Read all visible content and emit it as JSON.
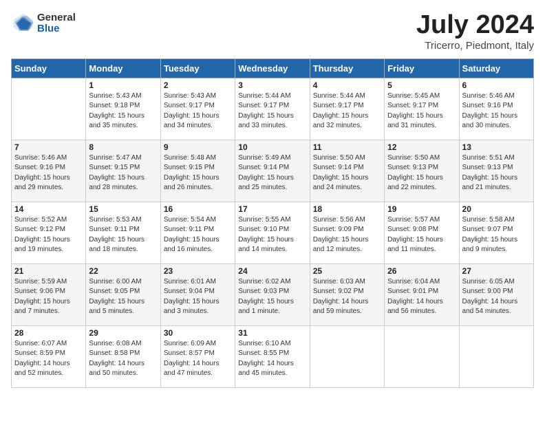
{
  "logo": {
    "general": "General",
    "blue": "Blue"
  },
  "title": "July 2024",
  "location": "Tricerro, Piedmont, Italy",
  "days_of_week": [
    "Sunday",
    "Monday",
    "Tuesday",
    "Wednesday",
    "Thursday",
    "Friday",
    "Saturday"
  ],
  "weeks": [
    [
      {
        "day": "",
        "info": ""
      },
      {
        "day": "1",
        "info": "Sunrise: 5:43 AM\nSunset: 9:18 PM\nDaylight: 15 hours\nand 35 minutes."
      },
      {
        "day": "2",
        "info": "Sunrise: 5:43 AM\nSunset: 9:17 PM\nDaylight: 15 hours\nand 34 minutes."
      },
      {
        "day": "3",
        "info": "Sunrise: 5:44 AM\nSunset: 9:17 PM\nDaylight: 15 hours\nand 33 minutes."
      },
      {
        "day": "4",
        "info": "Sunrise: 5:44 AM\nSunset: 9:17 PM\nDaylight: 15 hours\nand 32 minutes."
      },
      {
        "day": "5",
        "info": "Sunrise: 5:45 AM\nSunset: 9:17 PM\nDaylight: 15 hours\nand 31 minutes."
      },
      {
        "day": "6",
        "info": "Sunrise: 5:46 AM\nSunset: 9:16 PM\nDaylight: 15 hours\nand 30 minutes."
      }
    ],
    [
      {
        "day": "7",
        "info": "Sunrise: 5:46 AM\nSunset: 9:16 PM\nDaylight: 15 hours\nand 29 minutes."
      },
      {
        "day": "8",
        "info": "Sunrise: 5:47 AM\nSunset: 9:15 PM\nDaylight: 15 hours\nand 28 minutes."
      },
      {
        "day": "9",
        "info": "Sunrise: 5:48 AM\nSunset: 9:15 PM\nDaylight: 15 hours\nand 26 minutes."
      },
      {
        "day": "10",
        "info": "Sunrise: 5:49 AM\nSunset: 9:14 PM\nDaylight: 15 hours\nand 25 minutes."
      },
      {
        "day": "11",
        "info": "Sunrise: 5:50 AM\nSunset: 9:14 PM\nDaylight: 15 hours\nand 24 minutes."
      },
      {
        "day": "12",
        "info": "Sunrise: 5:50 AM\nSunset: 9:13 PM\nDaylight: 15 hours\nand 22 minutes."
      },
      {
        "day": "13",
        "info": "Sunrise: 5:51 AM\nSunset: 9:13 PM\nDaylight: 15 hours\nand 21 minutes."
      }
    ],
    [
      {
        "day": "14",
        "info": "Sunrise: 5:52 AM\nSunset: 9:12 PM\nDaylight: 15 hours\nand 19 minutes."
      },
      {
        "day": "15",
        "info": "Sunrise: 5:53 AM\nSunset: 9:11 PM\nDaylight: 15 hours\nand 18 minutes."
      },
      {
        "day": "16",
        "info": "Sunrise: 5:54 AM\nSunset: 9:11 PM\nDaylight: 15 hours\nand 16 minutes."
      },
      {
        "day": "17",
        "info": "Sunrise: 5:55 AM\nSunset: 9:10 PM\nDaylight: 15 hours\nand 14 minutes."
      },
      {
        "day": "18",
        "info": "Sunrise: 5:56 AM\nSunset: 9:09 PM\nDaylight: 15 hours\nand 12 minutes."
      },
      {
        "day": "19",
        "info": "Sunrise: 5:57 AM\nSunset: 9:08 PM\nDaylight: 15 hours\nand 11 minutes."
      },
      {
        "day": "20",
        "info": "Sunrise: 5:58 AM\nSunset: 9:07 PM\nDaylight: 15 hours\nand 9 minutes."
      }
    ],
    [
      {
        "day": "21",
        "info": "Sunrise: 5:59 AM\nSunset: 9:06 PM\nDaylight: 15 hours\nand 7 minutes."
      },
      {
        "day": "22",
        "info": "Sunrise: 6:00 AM\nSunset: 9:05 PM\nDaylight: 15 hours\nand 5 minutes."
      },
      {
        "day": "23",
        "info": "Sunrise: 6:01 AM\nSunset: 9:04 PM\nDaylight: 15 hours\nand 3 minutes."
      },
      {
        "day": "24",
        "info": "Sunrise: 6:02 AM\nSunset: 9:03 PM\nDaylight: 15 hours\nand 1 minute."
      },
      {
        "day": "25",
        "info": "Sunrise: 6:03 AM\nSunset: 9:02 PM\nDaylight: 14 hours\nand 59 minutes."
      },
      {
        "day": "26",
        "info": "Sunrise: 6:04 AM\nSunset: 9:01 PM\nDaylight: 14 hours\nand 56 minutes."
      },
      {
        "day": "27",
        "info": "Sunrise: 6:05 AM\nSunset: 9:00 PM\nDaylight: 14 hours\nand 54 minutes."
      }
    ],
    [
      {
        "day": "28",
        "info": "Sunrise: 6:07 AM\nSunset: 8:59 PM\nDaylight: 14 hours\nand 52 minutes."
      },
      {
        "day": "29",
        "info": "Sunrise: 6:08 AM\nSunset: 8:58 PM\nDaylight: 14 hours\nand 50 minutes."
      },
      {
        "day": "30",
        "info": "Sunrise: 6:09 AM\nSunset: 8:57 PM\nDaylight: 14 hours\nand 47 minutes."
      },
      {
        "day": "31",
        "info": "Sunrise: 6:10 AM\nSunset: 8:55 PM\nDaylight: 14 hours\nand 45 minutes."
      },
      {
        "day": "",
        "info": ""
      },
      {
        "day": "",
        "info": ""
      },
      {
        "day": "",
        "info": ""
      }
    ]
  ]
}
